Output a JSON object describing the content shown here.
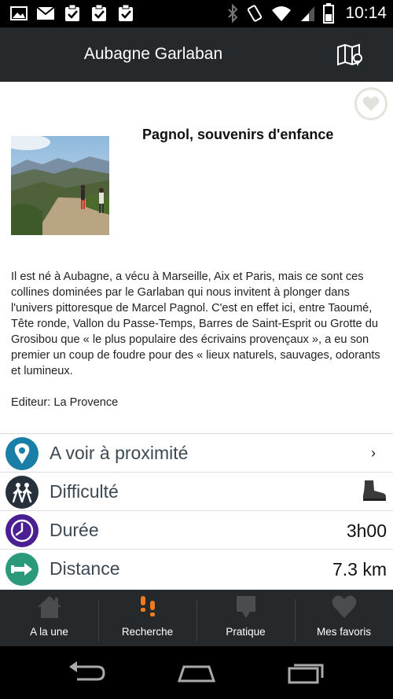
{
  "status_bar": {
    "time": "10:14",
    "left_icons": [
      "image-icon",
      "mail-icon",
      "clipboard-check-icon",
      "clipboard-check-icon",
      "clipboard-check-icon"
    ],
    "right_icons": [
      "bluetooth-icon",
      "vibrate-icon",
      "wifi-icon",
      "signal-icon",
      "battery-icon"
    ]
  },
  "app_bar": {
    "title": "Aubagne Garlaban",
    "map_icon": "map-pin-icon"
  },
  "content": {
    "title": "Pagnol, souvenirs d'enfance",
    "description": "Il est né à Aubagne, a vécu à Marseille, Aix et Paris, mais ce sont ces collines dominées par le Garlaban qui nous invitent à plonger dans l'univers pittoresque de Marcel Pagnol. C'est en effet ici, entre Taoumé, Tête ronde, Vallon du Passe-Temps, Barres de Saint-Esprit ou Grotte du Grosibou que « le plus populaire des écrivains provençaux », a eu son premier un coup de foudre pour des « lieux naturels, sauvages, odorants et lumineux.",
    "editor": "Editeur: La Provence"
  },
  "info_rows": [
    {
      "label": "A voir à proximité",
      "value": "",
      "icon": "location-pin-icon",
      "color": "#1a7fa6",
      "chevron": "›"
    },
    {
      "label": "Difficulté",
      "value": "",
      "icon": "hikers-icon",
      "color": "#26303a",
      "value_icon": "boot-icon"
    },
    {
      "label": "Durée",
      "value": "3h00",
      "icon": "clock-icon",
      "color": "#4b1e91"
    },
    {
      "label": "Distance",
      "value": "7.3 km",
      "icon": "arrow-right-icon",
      "color": "#2b9a7a"
    }
  ],
  "tabs": [
    {
      "label": "A la une",
      "icon": "home-icon",
      "active": false
    },
    {
      "label": "Recherche",
      "icon": "footprints-icon",
      "active": true
    },
    {
      "label": "Pratique",
      "icon": "speech-bubble-icon",
      "active": false
    },
    {
      "label": "Mes favoris",
      "icon": "heart-icon",
      "active": false
    }
  ],
  "colors": {
    "app_bar": "#26292c",
    "tab_active": "#f07b1f",
    "tab_inactive": "#4a4d50"
  }
}
